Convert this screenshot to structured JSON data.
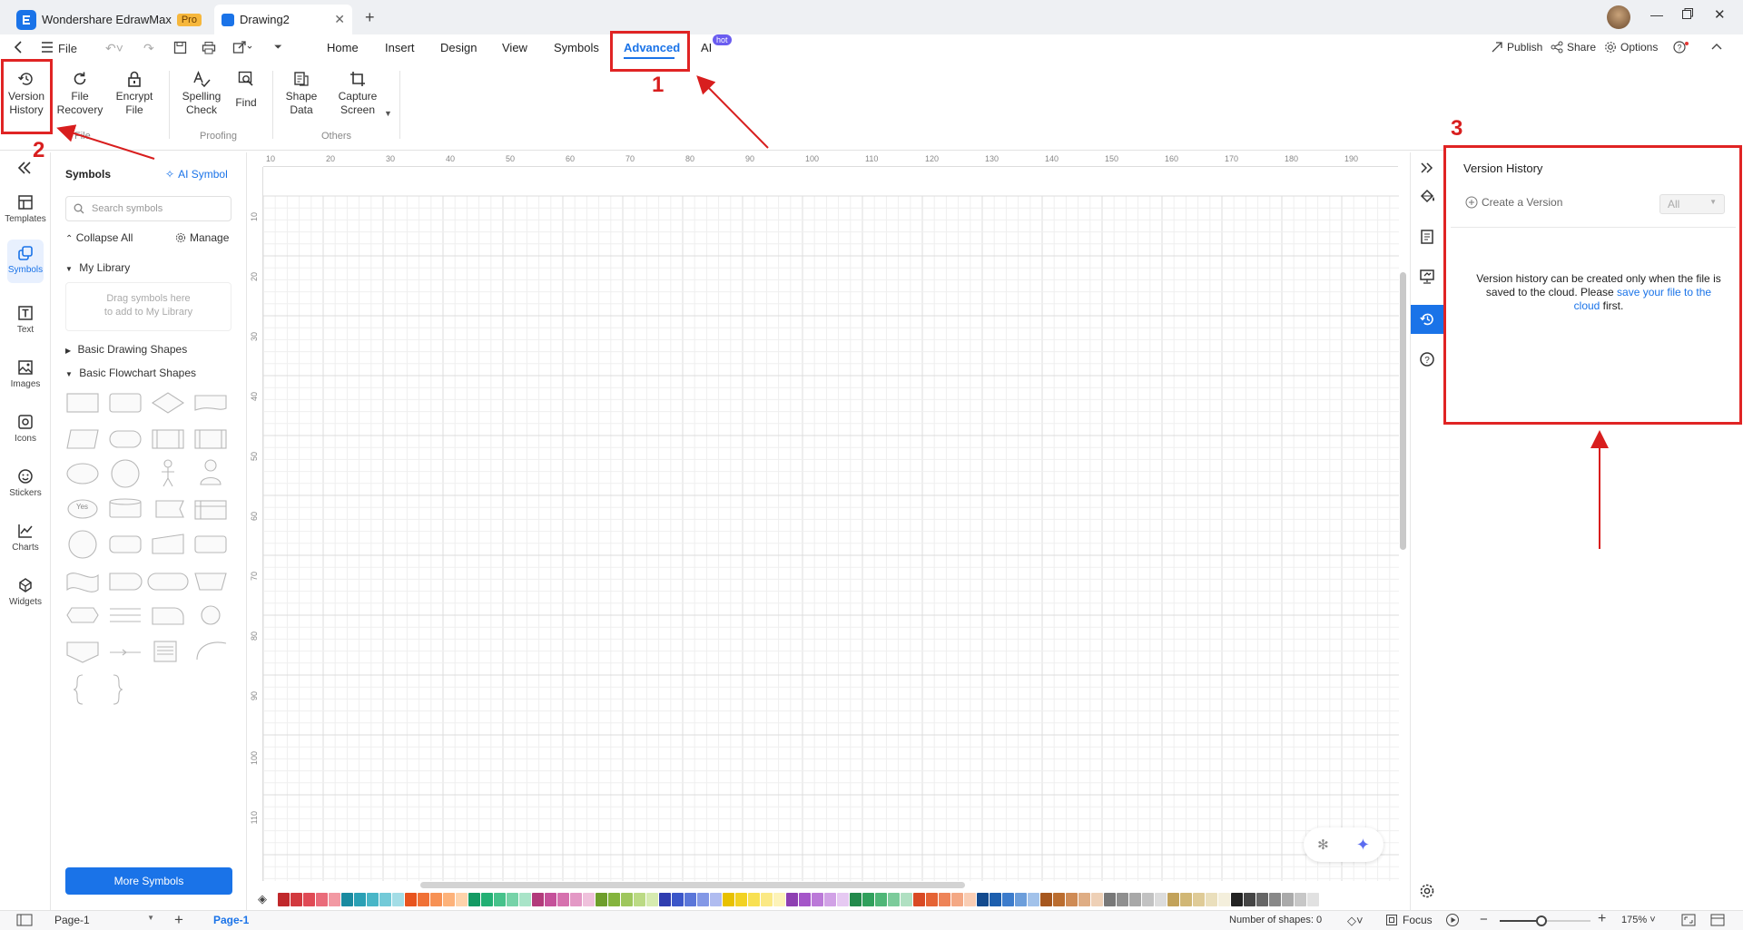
{
  "app": {
    "name": "Wondershare EdrawMax",
    "badge": "Pro",
    "doc_tab": "Drawing2"
  },
  "menubar": {
    "file_label": "File",
    "tabs": [
      "Home",
      "Insert",
      "Design",
      "View",
      "Symbols",
      "Advanced",
      "AI"
    ],
    "ai_badge": "hot",
    "right": {
      "publish": "Publish",
      "share": "Share",
      "options": "Options"
    }
  },
  "ribbon": {
    "buttons": [
      {
        "line1": "Version",
        "line2": "History"
      },
      {
        "line1": "File",
        "line2": "Recovery"
      },
      {
        "line1": "Encrypt",
        "line2": "File"
      },
      {
        "line1": "Spelling",
        "line2": "Check"
      },
      {
        "line1": "Find",
        "line2": ""
      },
      {
        "line1": "Shape",
        "line2": "Data"
      },
      {
        "line1": "Capture",
        "line2": "Screen"
      }
    ],
    "groups": [
      "File",
      "Proofing",
      "Others"
    ]
  },
  "leftbar": {
    "items": [
      "Templates",
      "Symbols",
      "Text",
      "Images",
      "Icons",
      "Stickers",
      "Charts",
      "Widgets"
    ]
  },
  "symbols_panel": {
    "title": "Symbols",
    "ai_symbol": "AI Symbol",
    "search_placeholder": "Search symbols",
    "collapse_all": "Collapse All",
    "manage": "Manage",
    "my_library": "My Library",
    "drop_hint_1": "Drag symbols here",
    "drop_hint_2": "to add to My Library",
    "section_basic_drawing": "Basic Drawing Shapes",
    "section_basic_flowchart": "Basic Flowchart Shapes",
    "yes_shape": "Yes",
    "more_symbols": "More Symbols"
  },
  "ruler": {
    "h": [
      "10",
      "20",
      "30",
      "40",
      "50",
      "60",
      "70",
      "80",
      "90",
      "100",
      "110",
      "120",
      "130",
      "140",
      "150",
      "160",
      "170",
      "180",
      "190"
    ],
    "v": [
      "10",
      "20",
      "30",
      "40",
      "50",
      "60",
      "70",
      "80",
      "90",
      "100",
      "110"
    ]
  },
  "version_history": {
    "title": "Version History",
    "create": "Create a Version",
    "filter": "All",
    "message_part1": "Version history can be created only when the file is saved to the cloud. Please ",
    "message_link": "save your file to the cloud",
    "message_part2": " first."
  },
  "annotations": {
    "n1": "1",
    "n2": "2",
    "n3": "3"
  },
  "status": {
    "page_select": "Page-1",
    "page_tab": "Page-1",
    "shapes_count": "Number of shapes: 0",
    "focus": "Focus",
    "zoom": "175%"
  },
  "colors": {
    "accent": "#1a73e8",
    "annotation_red": "#e02424",
    "palette": [
      "#c0282b",
      "#d2393e",
      "#e04a55",
      "#ea6b7a",
      "#f299a3",
      "#1a8aa0",
      "#2aa0b5",
      "#48b6c7",
      "#73cad8",
      "#a3dde6",
      "#e8541e",
      "#f07136",
      "#f79154",
      "#fdb27a",
      "#fed3ab",
      "#149a63",
      "#22b074",
      "#46c28b",
      "#76d3a8",
      "#a9e4c8",
      "#b23b7b",
      "#c5519a",
      "#d671ae",
      "#e398c5",
      "#efc1dc",
      "#6e9e2c",
      "#84b43d",
      "#9fc75d",
      "#bbda84",
      "#d6ebb0",
      "#2f3db0",
      "#3b56c9",
      "#5a76d9",
      "#8398e6",
      "#b0bcf0",
      "#e8c100",
      "#f2d222",
      "#f8e052",
      "#fbe985",
      "#fdf3b8",
      "#8e3fb2",
      "#a556c9",
      "#bb79d8",
      "#d1a1e6",
      "#e6c9f2",
      "#238a4c",
      "#30a05c",
      "#4fb677",
      "#7ccb9b",
      "#b0e0c2",
      "#d94a24",
      "#e56334",
      "#ee8458",
      "#f4a884",
      "#f9cdb4",
      "#134a8e",
      "#1d5fae",
      "#3c7ccc",
      "#6c9edb",
      "#a2c2ea",
      "#a6571e",
      "#bb6d2f",
      "#cf8b55",
      "#dfad84",
      "#eed0b6",
      "#787878",
      "#8f8f8f",
      "#a8a8a8",
      "#c2c2c2",
      "#dcdcdc",
      "#c2a25a",
      "#d1b775",
      "#dfcb97",
      "#eadfbc",
      "#f4efdc",
      "#222222",
      "#444444",
      "#666666",
      "#888888",
      "#aaaaaa",
      "#c7c7c7",
      "#e1e1e1"
    ]
  }
}
